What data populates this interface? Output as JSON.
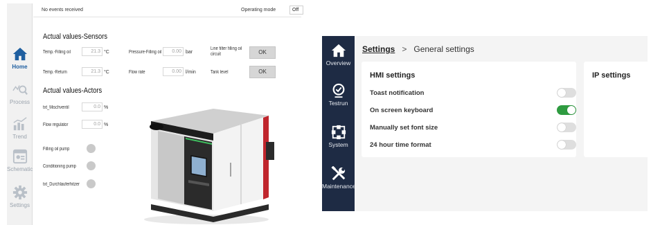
{
  "left": {
    "nav": [
      {
        "label": "Home",
        "icon": "home-icon",
        "active": true
      },
      {
        "label": "Process",
        "icon": "process-icon",
        "active": false
      },
      {
        "label": "Trend",
        "icon": "trend-icon",
        "active": false
      },
      {
        "label": "Schematic",
        "icon": "schematic-icon",
        "active": false
      },
      {
        "label": "Settings",
        "icon": "settings-icon",
        "active": false
      }
    ],
    "topbar": {
      "events_text": "No events received",
      "mode_label": "Operating mode",
      "mode_value": "Off"
    },
    "sensors": {
      "title": "Actual values-Sensors",
      "temp_filling_label": "Temp.-Filling oil",
      "temp_filling_value": "21.3",
      "temp_filling_unit": "°C",
      "temp_return_label": "Temp.-Return",
      "temp_return_value": "21.3",
      "temp_return_unit": "°C",
      "pressure_label": "Pressure-Filling oil",
      "pressure_value": "0.00",
      "pressure_unit": "bar",
      "flow_label": "Flow rate",
      "flow_value": "0.00",
      "flow_unit": "l/min",
      "line_filter_label": "Line filter filling oil circuit",
      "line_filter_status": "OK",
      "tank_label": "Tank level",
      "tank_status": "OK"
    },
    "actors": {
      "title": "Actual values-Actors",
      "item1_label": "txt_Mischventil",
      "item1_value": "0.0",
      "item1_unit": "%",
      "item2_label": "Flow regulator",
      "item2_value": "0.0",
      "item2_unit": "%",
      "pump1_label": "Filling oil pump",
      "pump2_label": "Conditioning pump",
      "pump3_label": "txt_Durchlauferhitzer"
    }
  },
  "right": {
    "nav": [
      {
        "label": "Overview",
        "icon": "home-icon"
      },
      {
        "label": "Testrun",
        "icon": "testrun-icon"
      },
      {
        "label": "System",
        "icon": "system-icon"
      },
      {
        "label": "Maintenance",
        "icon": "tools-icon"
      }
    ],
    "breadcrumb": {
      "parent": "Settings",
      "separator": ">",
      "current": "General settings"
    },
    "hmi": {
      "title": "HMI settings",
      "rows": [
        {
          "label": "Toast notification",
          "enabled": false
        },
        {
          "label": "On screen keyboard",
          "enabled": true
        },
        {
          "label": "Manually set font size",
          "enabled": false
        },
        {
          "label": "24 hour time format",
          "enabled": false
        }
      ]
    },
    "ip": {
      "title": "IP settings"
    }
  },
  "colors": {
    "left_accent": "#1f5fa0",
    "right_sidebar": "#1e2b44",
    "toggle_on": "#2e9b40",
    "machine_red": "#c0262d"
  }
}
